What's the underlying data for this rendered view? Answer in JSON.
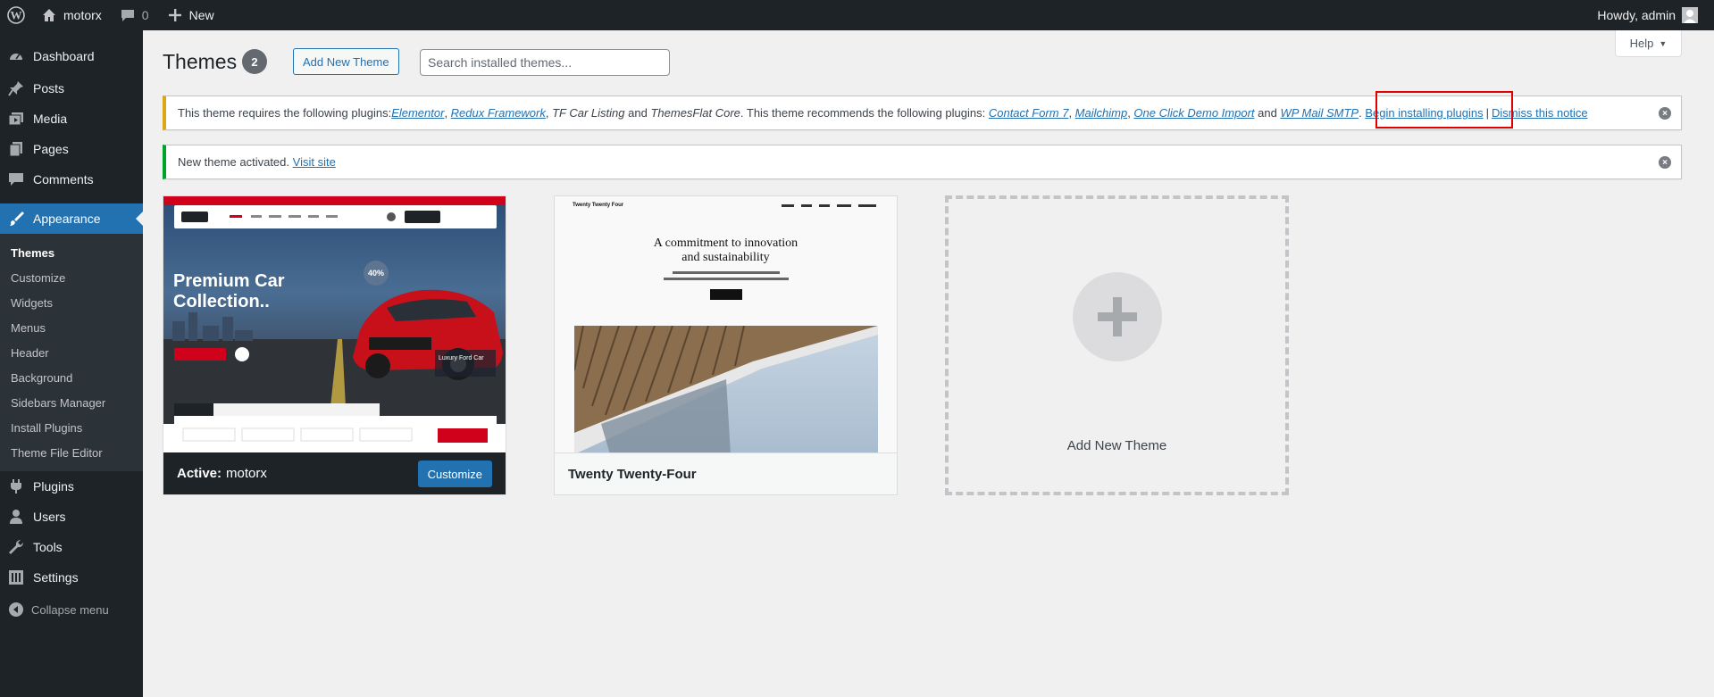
{
  "admin_bar": {
    "site_name": "motorx",
    "comments_count": "0",
    "new_label": "New",
    "howdy": "Howdy, admin"
  },
  "sidebar": {
    "items": [
      {
        "label": "Dashboard",
        "icon": "dashboard-icon"
      },
      {
        "label": "Posts",
        "icon": "pin-icon"
      },
      {
        "label": "Media",
        "icon": "media-icon"
      },
      {
        "label": "Pages",
        "icon": "page-icon"
      },
      {
        "label": "Comments",
        "icon": "comment-icon"
      },
      {
        "label": "Appearance",
        "icon": "brush-icon"
      }
    ],
    "appearance_submenu": [
      "Themes",
      "Customize",
      "Widgets",
      "Menus",
      "Header",
      "Background",
      "Sidebars Manager",
      "Install Plugins",
      "Theme File Editor"
    ],
    "items_after": [
      {
        "label": "Plugins",
        "icon": "plugin-icon"
      },
      {
        "label": "Users",
        "icon": "users-icon"
      },
      {
        "label": "Tools",
        "icon": "wrench-icon"
      },
      {
        "label": "Settings",
        "icon": "settings-icon"
      }
    ],
    "collapse_label": "Collapse menu"
  },
  "header": {
    "title": "Themes",
    "count": "2",
    "add_new_label": "Add New Theme",
    "search_placeholder": "Search installed themes...",
    "help_label": "Help"
  },
  "notice_plugins": {
    "text_start": "This theme requires the following plugins: ",
    "required_links": [
      "Elementor",
      "Redux Framework"
    ],
    "required_plain": [
      "TF Car Listing",
      "ThemesFlat Core"
    ],
    "text_mid": ". This theme recommends the following plugins: ",
    "recommended_links": [
      "Contact Form 7",
      "Mailchimp",
      "One Click Demo Import"
    ],
    "recommended_last": "WP Mail SMTP",
    "begin_installing": "Begin installing plugins",
    "dismiss": "Dismiss this notice",
    "and_word": "and",
    "sep": "|"
  },
  "notice_activated": {
    "text": "New theme activated.",
    "link": "Visit site"
  },
  "themes": {
    "active": {
      "prefix": "Active:",
      "name": "motorx",
      "customize_label": "Customize",
      "shot": {
        "hero_title_1": "Premium Car",
        "hero_title_2": "Collection..",
        "badge": "40%",
        "car_label": "Luxury Ford Car"
      }
    },
    "second": {
      "name": "Twenty Twenty-Four",
      "shot": {
        "site_title": "Twenty Twenty Four",
        "headline_1": "A commitment to innovation",
        "headline_2": "and sustainability"
      }
    },
    "add_new_label": "Add New Theme"
  },
  "colors": {
    "accent": "#2271b1",
    "admin_dark": "#1d2327",
    "warning": "#dba617",
    "success": "#00a32a",
    "highlight": "#e00000"
  }
}
